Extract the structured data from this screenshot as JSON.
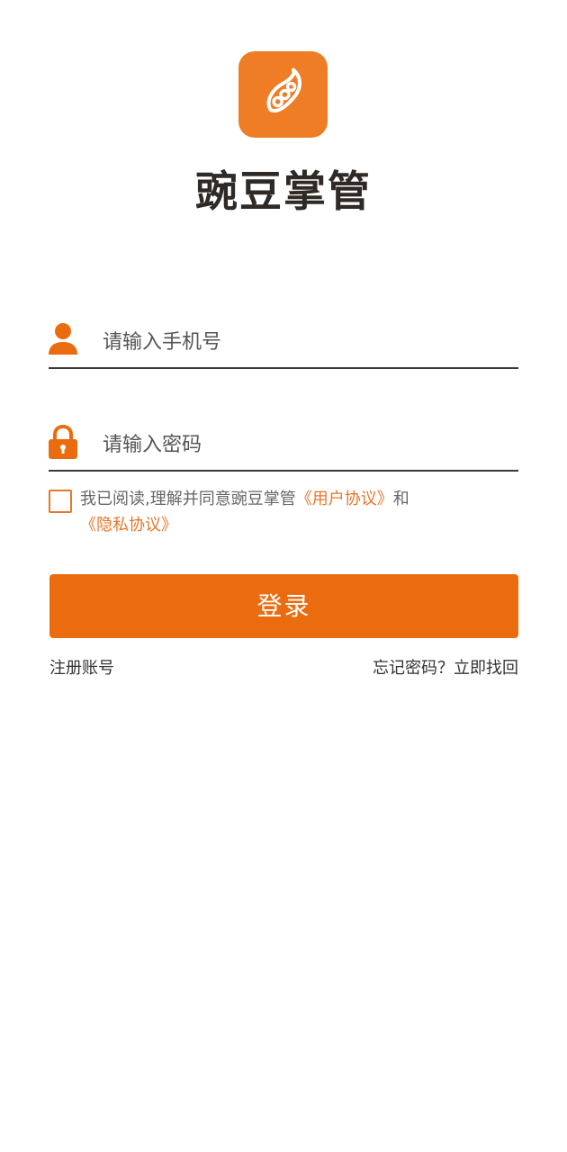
{
  "app": {
    "name": "豌豆掌管",
    "logo_icon": "pea-pod-icon",
    "brand_color": "#ee7d25",
    "button_color": "#eb6c0f"
  },
  "login_form": {
    "phone_placeholder": "请输入手机号",
    "phone_icon": "user-icon",
    "password_placeholder": "请输入密码",
    "password_icon": "lock-icon",
    "agreement": {
      "checked": false,
      "prefix": "我已阅读,理解并同意豌豆掌管",
      "user_agreement_link": "《用户协议》",
      "conjunction": "和",
      "privacy_policy_link": "《隐私协议》"
    },
    "login_button": "登录",
    "register_link": "注册账号",
    "forgot_password_link": "忘记密码？立即找回"
  }
}
